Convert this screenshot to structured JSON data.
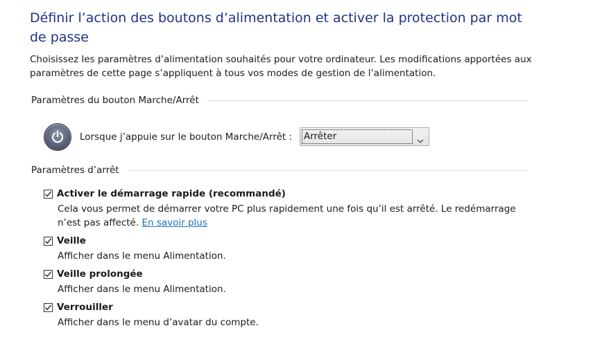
{
  "page": {
    "title": "Définir l’action des boutons d’alimentation et activer la protection par mot de passe",
    "intro": "Choisissez les paramètres d’alimentation souhaités pour votre ordinateur. Les modifications apportées aux paramètres de cette page s’appliquent à tous vos modes de gestion de l’alimentation."
  },
  "power_button_section": {
    "header": "Paramètres du bouton Marche/Arrêt",
    "icon": "power-icon",
    "label": "Lorsque j’appuie sur le bouton Marche/Arrêt :",
    "selected_value": "Arrêter"
  },
  "shutdown_section": {
    "header": "Paramètres d’arrêt",
    "options": [
      {
        "name": "Activer le démarrage rapide (recommandé)",
        "checked": true,
        "description": "Cela vous permet de démarrer votre PC plus rapidement une fois qu’il est arrêté. Le redémarrage n’est pas affecté.",
        "link": "En savoir plus"
      },
      {
        "name": "Veille",
        "checked": true,
        "description": "Afficher dans le menu Alimentation."
      },
      {
        "name": "Veille prolongée",
        "checked": true,
        "description": "Afficher dans le menu Alimentation."
      },
      {
        "name": "Verrouiller",
        "checked": true,
        "description": "Afficher dans le menu d’avatar du compte."
      }
    ]
  },
  "colors": {
    "title": "#1e3287",
    "link": "#1b6fb8",
    "rule": "#d8d8d8"
  }
}
